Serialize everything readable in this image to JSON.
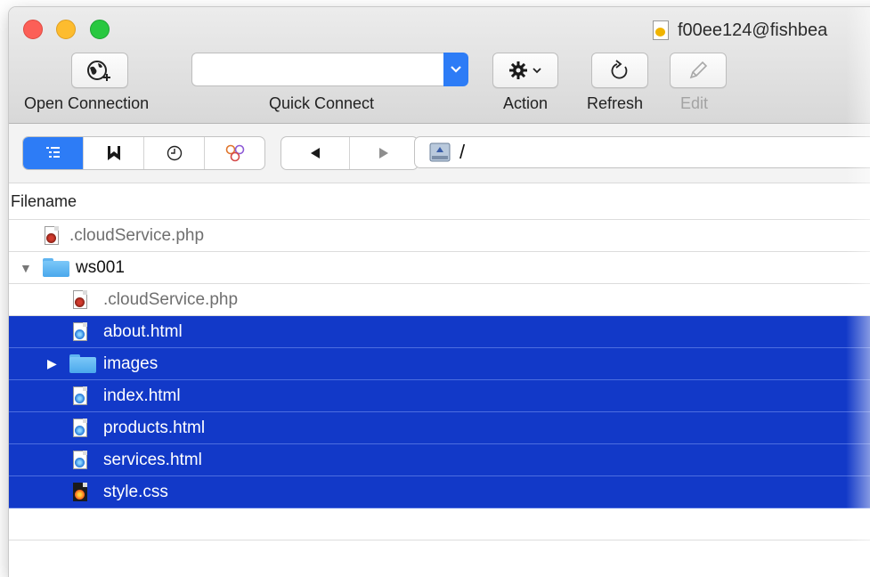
{
  "window": {
    "title": "f00ee124@fishbea"
  },
  "toolbar": {
    "open_connection_label": "Open Connection",
    "quick_connect_label": "Quick Connect",
    "quick_connect_value": "",
    "action_label": "Action",
    "refresh_label": "Refresh",
    "edit_label": "Edit"
  },
  "nav": {
    "path": "/"
  },
  "columns": {
    "filename": "Filename"
  },
  "files": [
    {
      "name": ".cloudService.php",
      "kind": "php-file",
      "level": 0,
      "selected": false
    },
    {
      "name": "ws001",
      "kind": "folder",
      "level": 0,
      "expanded": true,
      "selected": false
    },
    {
      "name": ".cloudService.php",
      "kind": "php-file",
      "level": 1,
      "selected": false
    },
    {
      "name": "about.html",
      "kind": "html-file",
      "level": 1,
      "selected": true
    },
    {
      "name": "images",
      "kind": "folder",
      "level": 1,
      "expanded": false,
      "selected": true
    },
    {
      "name": "index.html",
      "kind": "html-file",
      "level": 1,
      "selected": true
    },
    {
      "name": "products.html",
      "kind": "html-file",
      "level": 1,
      "selected": true
    },
    {
      "name": "services.html",
      "kind": "html-file",
      "level": 1,
      "selected": true
    },
    {
      "name": "style.css",
      "kind": "css-file",
      "level": 1,
      "selected": true
    }
  ],
  "colors": {
    "selection": "#1239c8",
    "accent": "#2d7cf6"
  }
}
